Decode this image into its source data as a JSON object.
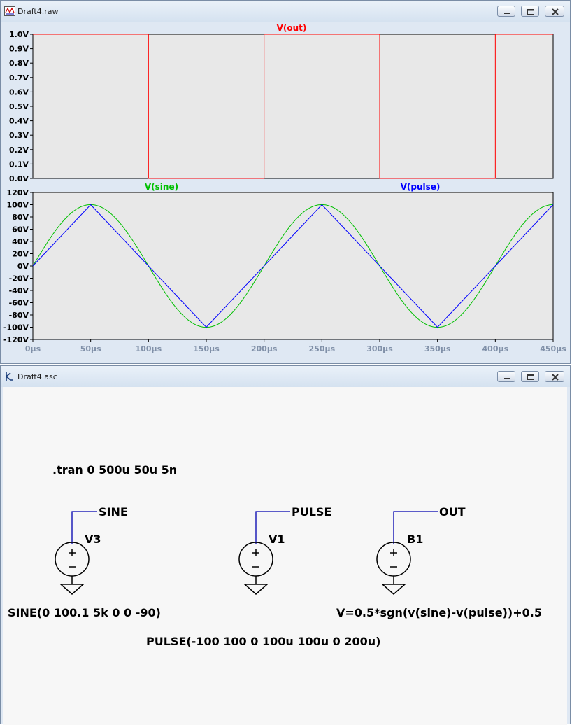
{
  "waveform_window": {
    "title": "Draft4.raw",
    "buttons": [
      "minimize",
      "maximize",
      "close"
    ]
  },
  "schematic_window": {
    "title": "Draft4.asc",
    "buttons": [
      "minimize",
      "maximize",
      "close"
    ]
  },
  "chart_data": [
    {
      "type": "line",
      "title": "V(out)",
      "xlabel": "",
      "ylabel": "",
      "xlim": [
        0,
        450
      ],
      "ylim": [
        0,
        1
      ],
      "grid": false,
      "y_ticks": [
        "1.0V",
        "0.9V",
        "0.8V",
        "0.7V",
        "0.6V",
        "0.5V",
        "0.4V",
        "0.3V",
        "0.2V",
        "0.1V",
        "0.0V"
      ],
      "series": [
        {
          "name": "V(out)",
          "color": "#ff0000",
          "x": [
            0,
            100,
            100,
            200,
            200,
            300,
            300,
            400,
            400,
            450
          ],
          "y": [
            1,
            1,
            0,
            0,
            1,
            1,
            0,
            0,
            1,
            1
          ]
        }
      ]
    },
    {
      "type": "line",
      "title": "",
      "xlabel": "",
      "ylabel": "",
      "xlim": [
        0,
        450
      ],
      "ylim": [
        -120,
        120
      ],
      "grid": false,
      "y_ticks": [
        "120V",
        "100V",
        "80V",
        "60V",
        "40V",
        "20V",
        "0V",
        "-20V",
        "-40V",
        "-60V",
        "-80V",
        "-100V",
        "-120V"
      ],
      "x_ticks": [
        "0µs",
        "50µs",
        "100µs",
        "150µs",
        "200µs",
        "250µs",
        "300µs",
        "350µs",
        "400µs",
        "450µs"
      ],
      "series": [
        {
          "name": "V(sine)",
          "color": "#00c000",
          "function": "100.1*sin(2*pi*5000*t)",
          "x": [
            0,
            25,
            50,
            75,
            100,
            125,
            150,
            175,
            200,
            225,
            250,
            275,
            300,
            325,
            350,
            375,
            400,
            425,
            450
          ],
          "y": [
            0,
            70.8,
            100.1,
            70.8,
            0,
            -70.8,
            -100.1,
            -70.8,
            0,
            70.8,
            100.1,
            70.8,
            0,
            -70.8,
            -100.1,
            -70.8,
            0,
            70.8,
            100.1
          ]
        },
        {
          "name": "V(pulse)",
          "color": "#0000ff",
          "x": [
            0,
            50,
            150,
            250,
            350,
            450
          ],
          "y": [
            0,
            100,
            -100,
            100,
            -100,
            100
          ]
        }
      ]
    }
  ],
  "schematic": {
    "directive": ".tran 0 500u 50u 5n",
    "components": [
      {
        "name": "V3",
        "net": "SINE",
        "value": "SINE(0 100.1 5k 0 0 -90)"
      },
      {
        "name": "V1",
        "net": "PULSE",
        "value": "PULSE(-100 100 0 100u 100u 0 200u)"
      },
      {
        "name": "B1",
        "net": "OUT",
        "value": "V=0.5*sgn(v(sine)-v(pulse))+0.5"
      }
    ]
  }
}
